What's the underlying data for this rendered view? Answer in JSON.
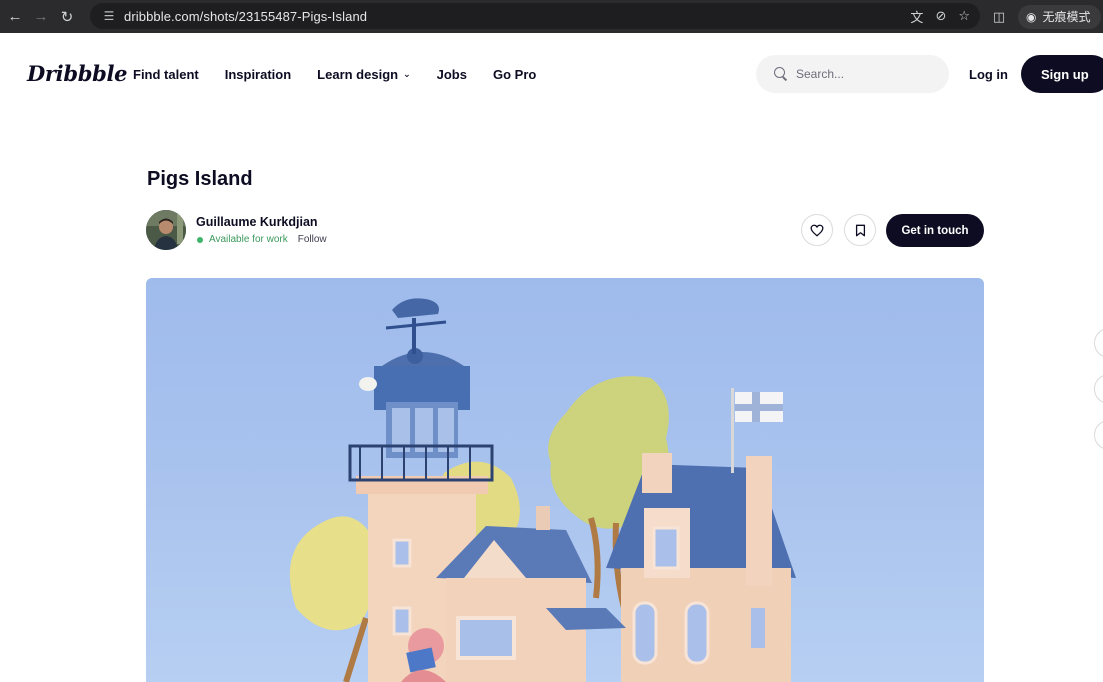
{
  "browser": {
    "url": "dribbble.com/shots/23155487-Pigs-Island",
    "incognito_label": "无痕模式"
  },
  "header": {
    "logo": "Dribbble",
    "nav": [
      {
        "label": "Find talent"
      },
      {
        "label": "Inspiration"
      },
      {
        "label": "Learn design"
      },
      {
        "label": "Jobs"
      },
      {
        "label": "Go Pro"
      }
    ],
    "search_placeholder": "Search...",
    "login_label": "Log in",
    "signup_label": "Sign up"
  },
  "shot": {
    "title": "Pigs Island",
    "author": {
      "name": "Guillaume Kurkdjian",
      "availability": "Available for work",
      "follow_label": "Follow"
    },
    "contact_label": "Get in touch"
  },
  "colors": {
    "brand_dark": "#0d0c22",
    "available_green": "#3db36b",
    "sky": "#a9c3ee"
  }
}
